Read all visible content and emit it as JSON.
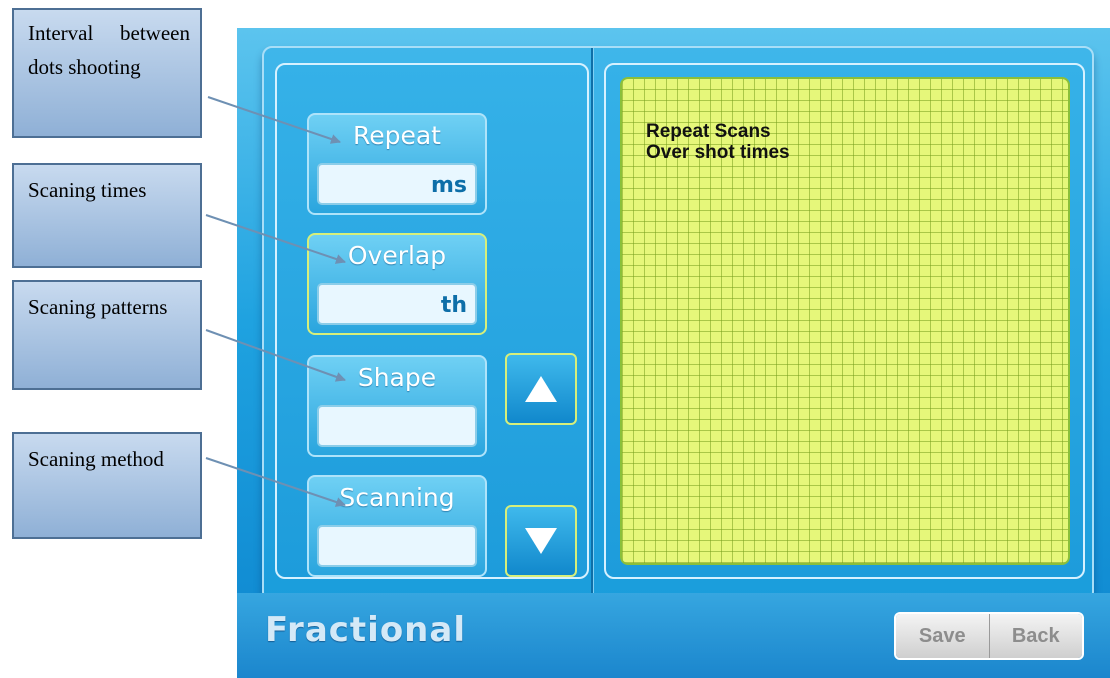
{
  "callouts": [
    {
      "text": "Interval between dots shooting"
    },
    {
      "text": "Scaning times"
    },
    {
      "text": "Scaning patterns"
    },
    {
      "text": "Scaning method"
    }
  ],
  "params": [
    {
      "label": "Repeat",
      "unit": "ms",
      "selected": false
    },
    {
      "label": "Overlap",
      "unit": "th",
      "selected": true
    },
    {
      "label": "Shape",
      "unit": "",
      "selected": false
    },
    {
      "label": "Scanning",
      "unit": "",
      "selected": false
    }
  ],
  "display": {
    "line1": "Repeat Scans",
    "line2": "Over shot times"
  },
  "footer": {
    "title": "Fractional",
    "save_label": "Save",
    "back_label": "Back"
  },
  "icons": {
    "up": "triangle-up-icon",
    "down": "triangle-down-icon"
  },
  "colors": {
    "screen_blue": "#1fa2e0",
    "grid_yellow": "#e6f77a",
    "selected_border": "#d7ef7a"
  }
}
